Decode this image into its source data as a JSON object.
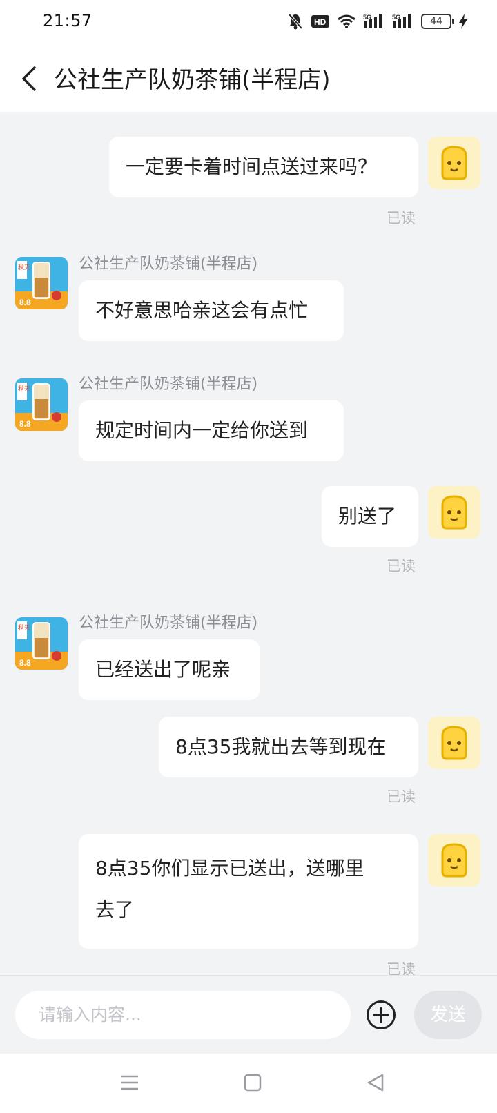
{
  "status_bar": {
    "time": "21:57",
    "hd_label": "HD",
    "signal1_label": "5G",
    "signal2_label": "5G",
    "battery": "44",
    "icons": [
      "mute-bell-icon",
      "hd-icon",
      "wifi-icon",
      "signal-icon",
      "signal-icon",
      "battery-icon",
      "charging-icon"
    ]
  },
  "header": {
    "title": "公社生产队奶茶铺(半程店)"
  },
  "shop_name": "公社生产队奶茶铺(半程店)",
  "read_label": "已读",
  "messages": [
    {
      "from": "user",
      "text": "一定要卡着时间点送过来吗？",
      "read": "已读"
    },
    {
      "from": "shop",
      "sender": "公社生产队奶茶铺(半程店)",
      "text": "不好意思哈亲这会有点忙"
    },
    {
      "from": "shop",
      "sender": "公社生产队奶茶铺(半程店)",
      "text": "规定时间内一定给你送到"
    },
    {
      "from": "user",
      "text": "别送了",
      "read": "已读"
    },
    {
      "from": "shop",
      "sender": "公社生产队奶茶铺(半程店)",
      "text": "已经送出了呢亲"
    },
    {
      "from": "user",
      "text": "8点35我就出去等到现在",
      "read": "已读"
    },
    {
      "from": "user",
      "text_line1": "8点35你们显示已送出，送哪里",
      "text_line2": "去了",
      "read": "已读"
    }
  ],
  "input_bar": {
    "placeholder": "请输入内容...",
    "send_label": "发送"
  },
  "shop_avatar": {
    "badge_text": "8.8",
    "side_text": "秋天"
  },
  "colors": {
    "background": "#f2f3f5",
    "bubble": "#ffffff",
    "user_avatar_bg": "#fdf1c6",
    "user_avatar_face": "#ffd23f",
    "shop_avatar_bg": "#3fb3e3",
    "read_text": "#b5b7bc"
  }
}
